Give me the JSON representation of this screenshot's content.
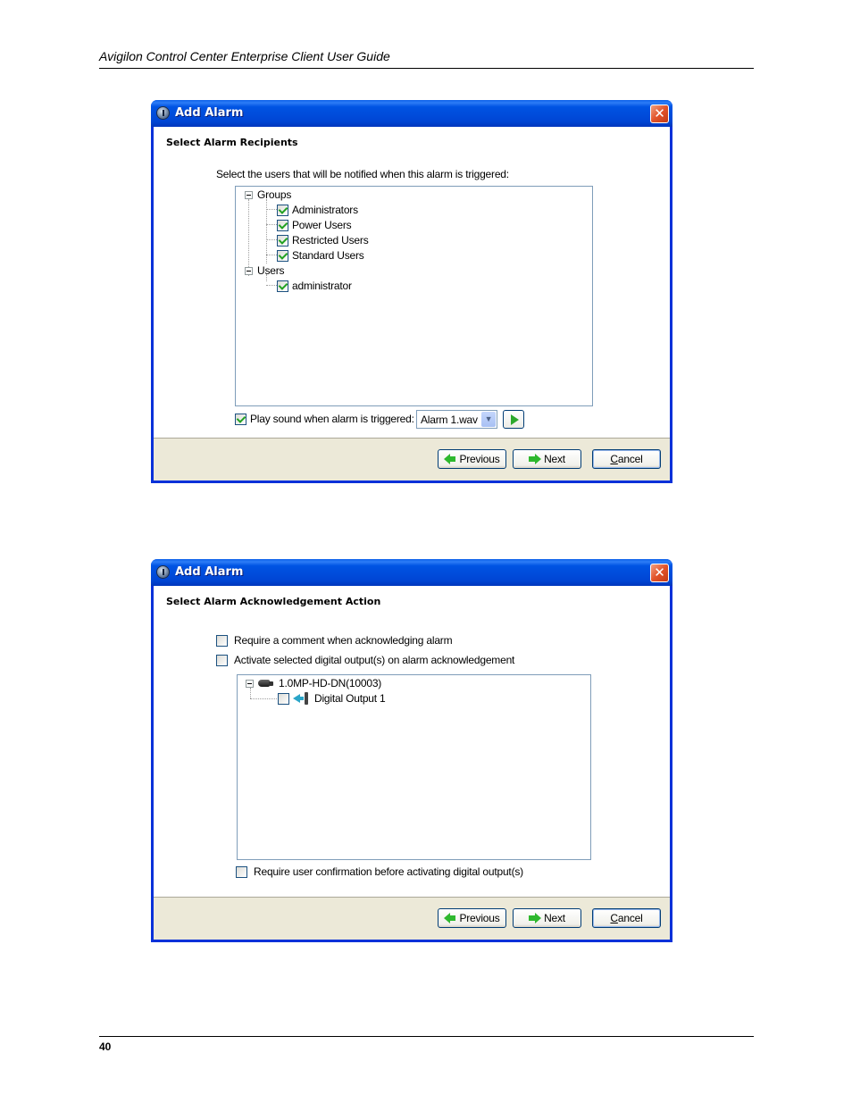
{
  "document": {
    "header_title": "Avigilon Control Center Enterprise Client User Guide",
    "page_number": "40"
  },
  "dialog1": {
    "title": "Add Alarm",
    "section_title": "Select Alarm Recipients",
    "instruction": "Select the users that will be notified when this alarm is triggered:",
    "tree": {
      "groups_label": "Groups",
      "groups": [
        {
          "label": "Administrators",
          "checked": true
        },
        {
          "label": "Power Users",
          "checked": true
        },
        {
          "label": "Restricted Users",
          "checked": true
        },
        {
          "label": "Standard Users",
          "checked": true
        }
      ],
      "users_label": "Users",
      "users": [
        {
          "label": "administrator",
          "checked": true
        }
      ]
    },
    "play_sound": {
      "label": "Play sound when alarm is triggered:",
      "checked": true
    },
    "sound_select": {
      "value": "Alarm 1.wav"
    },
    "buttons": {
      "previous": "Previous",
      "next": "Next",
      "cancel_underline": "C",
      "cancel_rest": "ancel"
    }
  },
  "dialog2": {
    "title": "Add Alarm",
    "section_title": "Select Alarm Acknowledgement Action",
    "options": [
      {
        "label": "Require a comment when acknowledging alarm",
        "checked": false
      },
      {
        "label": "Activate selected digital output(s) on alarm acknowledgement",
        "checked": false
      }
    ],
    "tree": {
      "device_label": "1.0MP-HD-DN(10003)",
      "outputs": [
        {
          "label": "Digital Output 1",
          "checked": false
        }
      ]
    },
    "confirm": {
      "label": "Require user confirmation before activating digital output(s)",
      "checked": false
    },
    "buttons": {
      "previous": "Previous",
      "next": "Next",
      "cancel_underline": "C",
      "cancel_rest": "ancel"
    }
  }
}
